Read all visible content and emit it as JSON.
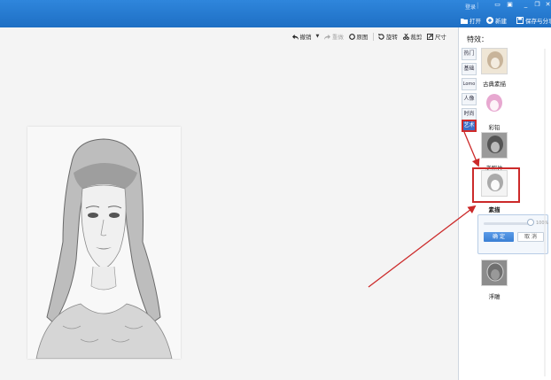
{
  "titlebar": {
    "login_label": "登录",
    "open_label": "打开",
    "new_label": "新建",
    "save_label": "保存与分享"
  },
  "toolbar": {
    "undo_label": "撤销",
    "redo_label": "重做",
    "original_label": "原图",
    "rotate_label": "旋转",
    "crop_label": "裁剪",
    "resize_label": "尺寸"
  },
  "panel": {
    "title": "特效：",
    "categories": [
      "热门",
      "基础",
      "Lomo",
      "人像",
      "时尚",
      "艺术"
    ],
    "active_category": "艺术",
    "effects": [
      "古典素描",
      "彩铅",
      "老照片",
      "素描",
      "浮雕"
    ],
    "selected_effect": "素描",
    "slider_value": "100%",
    "confirm_label": "确 定",
    "cancel_label": "取 消"
  },
  "colors": {
    "titlebar": "#1e6fc4",
    "accent_blue": "#3c70c8",
    "annotation_red": "#cc2a2a"
  }
}
